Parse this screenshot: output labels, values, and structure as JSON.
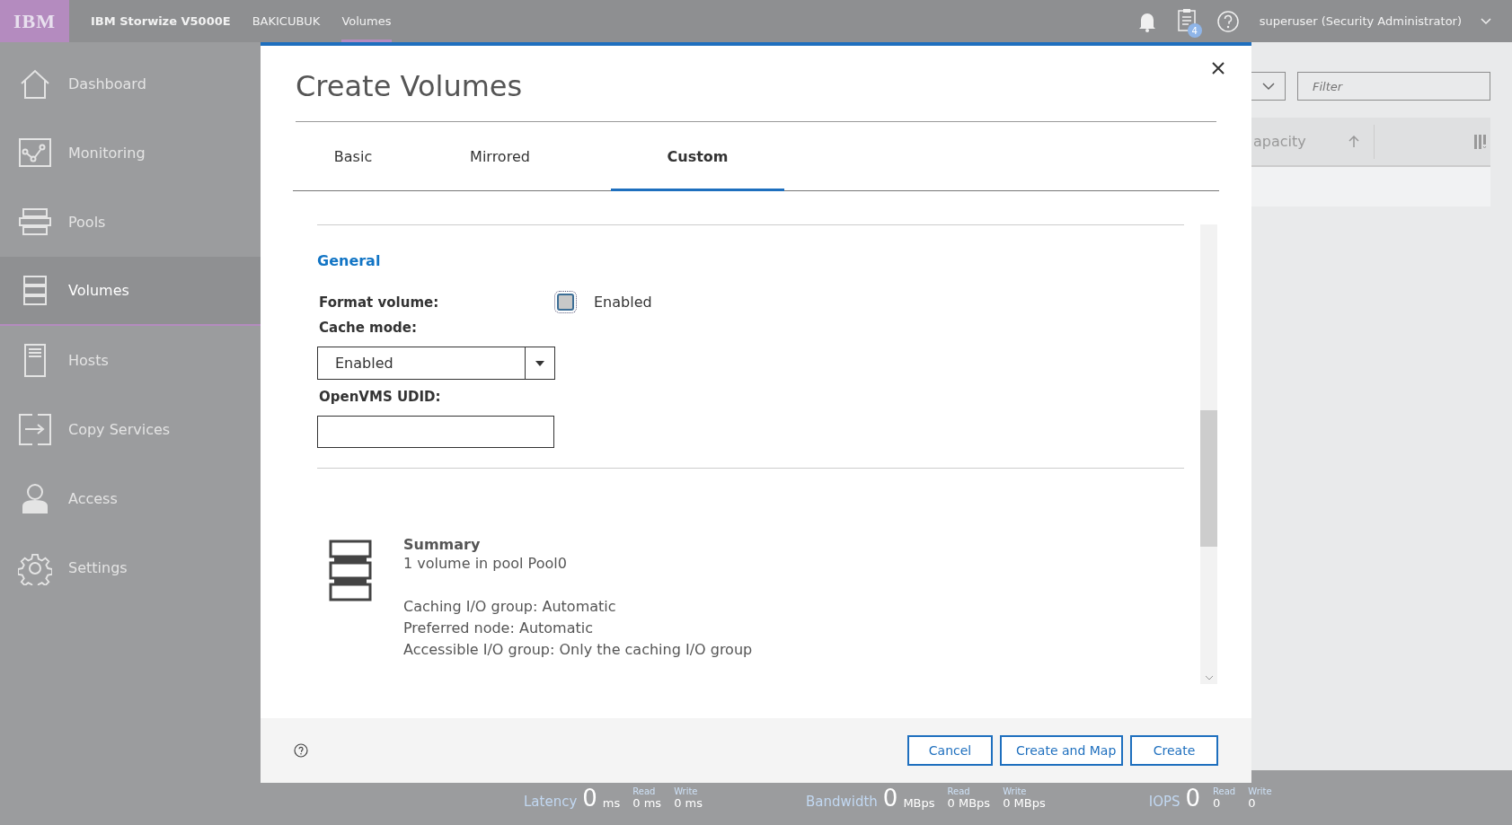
{
  "topbar": {
    "logo": "IBM",
    "product": "IBM Storwize V5000E",
    "system": "BAKICUBUK",
    "page": "Volumes",
    "tasks_badge": "4",
    "user": "superuser (Security Administrator)"
  },
  "sidebar": {
    "items": [
      {
        "label": "Dashboard",
        "kind": "house",
        "selected": false
      },
      {
        "label": "Monitoring",
        "kind": "chart",
        "selected": false
      },
      {
        "label": "Pools",
        "kind": "pools",
        "selected": false
      },
      {
        "label": "Volumes",
        "kind": "volumes",
        "selected": true
      },
      {
        "label": "Hosts",
        "kind": "host",
        "selected": false
      },
      {
        "label": "Copy Services",
        "kind": "copy",
        "selected": false
      },
      {
        "label": "Access",
        "kind": "user",
        "selected": false
      },
      {
        "label": "Settings",
        "kind": "gear",
        "selected": false
      }
    ]
  },
  "background_page": {
    "filter": {
      "placeholder": "Filter"
    },
    "column": {
      "label": "apacity"
    }
  },
  "dialog": {
    "title": "Create Volumes",
    "tabs": [
      {
        "label": "Basic",
        "selected": false
      },
      {
        "label": "Mirrored",
        "selected": false
      },
      {
        "label": "Custom",
        "selected": true
      }
    ],
    "section": {
      "title": "General"
    },
    "fields": [
      {
        "kind": "checkbox",
        "label": "Format volume:",
        "option": "Enabled",
        "checked": false
      },
      {
        "kind": "select",
        "label": "Cache mode:",
        "value": "Enabled"
      },
      {
        "kind": "text",
        "label": "OpenVMS UDID:"
      }
    ],
    "summary": {
      "title": "Summary",
      "groups": [
        [
          "1 volume in pool Pool0"
        ],
        [
          "Caching I/O group: Automatic",
          "Preferred node: Automatic",
          "Accessible I/O group: Only the caching I/O group"
        ]
      ]
    },
    "buttons": [
      {
        "label": "Cancel"
      },
      {
        "label": "Create and Map"
      },
      {
        "label": "Create"
      }
    ]
  },
  "status_bar": {
    "metrics": [
      {
        "label": "Latency",
        "value": "0",
        "unit": "ms",
        "read_label": "Read",
        "read": "0 ms",
        "write_label": "Write",
        "write": "0 ms"
      },
      {
        "label": "Bandwidth",
        "value": "0",
        "unit": "MBps",
        "read_label": "Read",
        "read": "0 MBps",
        "write_label": "Write",
        "write": "0 MBps"
      },
      {
        "label": "IOPS",
        "value": "0",
        "read_label": "Read",
        "read": "0",
        "write_label": "Write",
        "write": "0"
      }
    ]
  }
}
